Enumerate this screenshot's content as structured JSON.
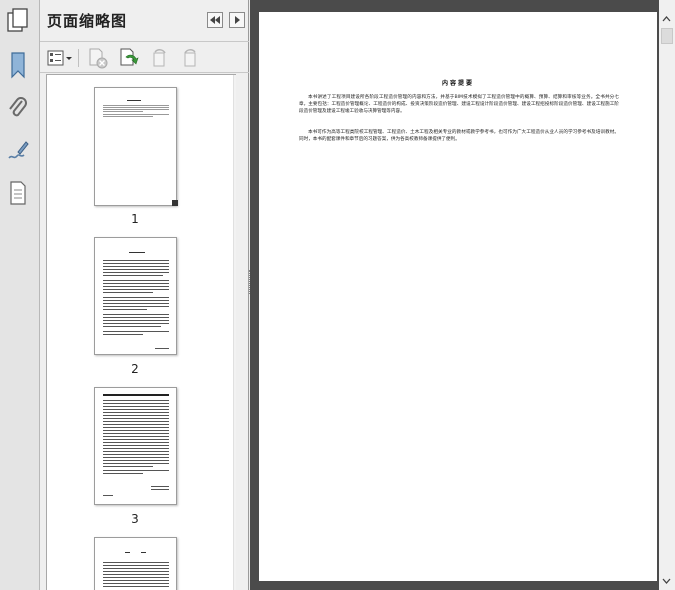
{
  "panel": {
    "title": "页面缩略图"
  },
  "thumbnails": [
    {
      "label": "1"
    },
    {
      "label": "2"
    },
    {
      "label": "3"
    }
  ],
  "document": {
    "heading": "内容提要",
    "paragraphs": [
      "本书讲述了工程项目建设所各阶段工程造价管理的内容和方法，并基于BIM技术模拟了工程造价管理中的概算、预算、结算和审核等业务。全书共分七章，主要包括：工程造价管理概论、工程造价的构成、投资决策阶段造价管理、建设工程设计阶段造价管理、建设工程招投标阶段造价管理、建设工程施工阶段造价管理及建设工程竣工验收与决算管理等内容。",
      "本书可作为高等工程类院校工程管理、工程造价、土木工程及相关专业的教材或教学参考书，也可作为广大工程造价从业人员的学习参考书及培训教材。同时，本书的配套课件和章节后的习题答案，供为各高校教师备课提供了便利。"
    ]
  }
}
